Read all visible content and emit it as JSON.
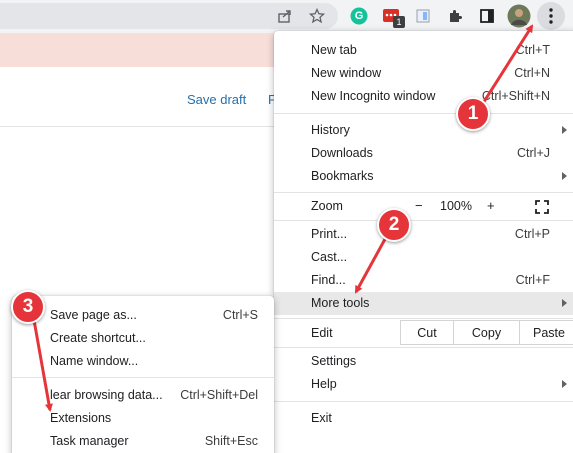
{
  "page": {
    "save_draft": "Save draft",
    "preview_partial": "P"
  },
  "chrome_menu": {
    "items": {
      "new_tab": {
        "label": "New tab",
        "shortcut": "Ctrl+T"
      },
      "new_window": {
        "label": "New window",
        "shortcut": "Ctrl+N"
      },
      "new_incognito": {
        "label": "New Incognito window",
        "shortcut": "Ctrl+Shift+N"
      },
      "history": {
        "label": "History"
      },
      "downloads": {
        "label": "Downloads",
        "shortcut": "Ctrl+J"
      },
      "bookmarks": {
        "label": "Bookmarks"
      },
      "zoom": {
        "label": "Zoom",
        "minus": "−",
        "value": "100%",
        "plus": "+"
      },
      "print": {
        "label": "Print...",
        "shortcut": "Ctrl+P"
      },
      "cast": {
        "label": "Cast..."
      },
      "find": {
        "label": "Find...",
        "shortcut": "Ctrl+F"
      },
      "more_tools": {
        "label": "More tools"
      },
      "edit": {
        "label": "Edit",
        "cut": "Cut",
        "copy": "Copy",
        "paste": "Paste"
      },
      "settings": {
        "label": "Settings"
      },
      "help": {
        "label": "Help"
      },
      "exit": {
        "label": "Exit"
      }
    }
  },
  "more_tools_menu": {
    "items": {
      "save_page": {
        "label": "Save page as...",
        "shortcut": "Ctrl+S"
      },
      "create_shortcut": {
        "label": "Create shortcut..."
      },
      "name_window": {
        "label": "Name window..."
      },
      "clear_browsing": {
        "label": "lear browsing data...",
        "shortcut": "Ctrl+Shift+Del"
      },
      "extensions": {
        "label": "Extensions"
      },
      "task_manager": {
        "label": "Task manager",
        "shortcut": "Shift+Esc"
      }
    }
  },
  "annotations": {
    "step1": "1",
    "step2": "2",
    "step3": "3"
  },
  "toolbar": {
    "ext_badge_count": "1",
    "grammarly_letter": "G"
  },
  "colors": {
    "annotation_red": "#e5353a",
    "highlight_bg": "#e8e8e8",
    "toolbar_bg": "#f1f3f4",
    "page_band": "#f8ded9",
    "link_blue": "#2271b1"
  }
}
